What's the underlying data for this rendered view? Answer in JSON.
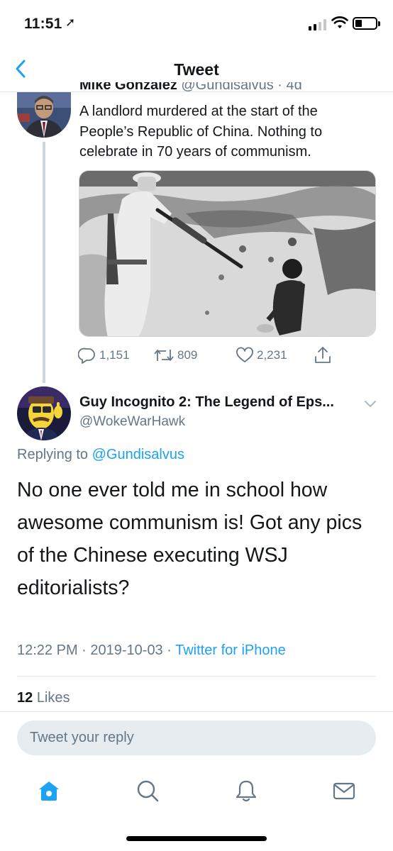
{
  "status_bar": {
    "time": "11:51",
    "location_glyph": "➚"
  },
  "nav": {
    "title": "Tweet"
  },
  "main_tweet": {
    "author_name_partial": "Mike Gonzalez",
    "author_handle_partial": "@Gundisalvus · 4d",
    "text": "A landlord murdered at the start of the People’s Republic of China. Nothing to celebrate in 70 years of communism.",
    "replies": "1,151",
    "retweets": "809",
    "likes": "2,231"
  },
  "reply_tweet": {
    "author_name": "Guy Incognito 2: The Legend of Eps...",
    "author_handle": "@WokeWarHawk",
    "replying_prefix": "Replying to",
    "replying_handle": "@Gundisalvus",
    "text": "No one ever told me in school how awesome communism is! Got any pics of the Chinese executing WSJ editorialists?",
    "timestamp": "12:22 PM · 2019-10-03 · ",
    "source": "Twitter for iPhone",
    "like_count": "12",
    "like_label": "Likes"
  },
  "compose": {
    "placeholder": "Tweet your reply"
  },
  "colors": {
    "accent": "#1da1f2",
    "secondary_text": "#657786",
    "divider": "#e1e8ed"
  },
  "icons": [
    "back-chevron-icon",
    "reply-icon",
    "retweet-icon",
    "like-icon",
    "share-icon",
    "chevron-down-icon",
    "home-icon",
    "search-icon",
    "notifications-icon",
    "messages-icon"
  ]
}
